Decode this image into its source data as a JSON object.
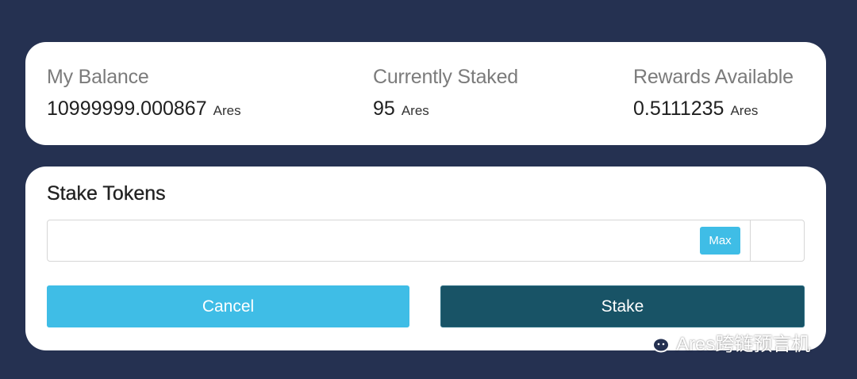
{
  "balances": {
    "my_balance": {
      "label": "My Balance",
      "value": "10999999.000867",
      "unit": "Ares"
    },
    "currently_staked": {
      "label": "Currently Staked",
      "value": "95",
      "unit": "Ares"
    },
    "rewards_available": {
      "label": "Rewards Available",
      "value": "0.5111235",
      "unit": "Ares"
    }
  },
  "stake_form": {
    "title": "Stake Tokens",
    "amount_value": "",
    "max_label": "Max",
    "cancel_label": "Cancel",
    "stake_label": "Stake"
  },
  "watermark": {
    "text": "Ares跨链预言机",
    "icon": "wechat-icon"
  },
  "colors": {
    "background": "#253151",
    "card": "#ffffff",
    "accent": "#3fbde6",
    "stake_button": "#185366"
  }
}
